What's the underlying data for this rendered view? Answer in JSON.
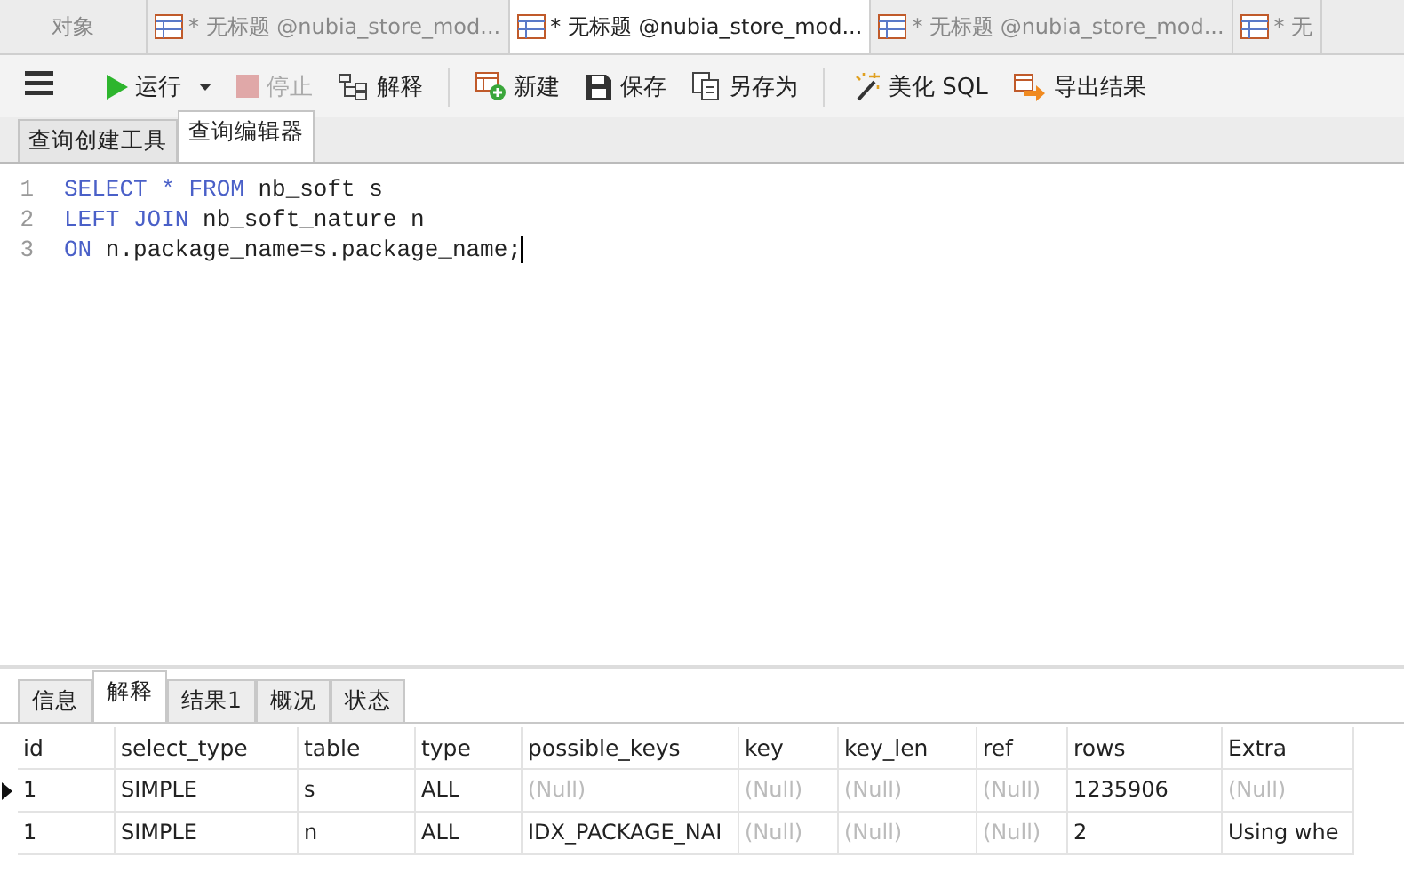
{
  "doc_tabs": [
    {
      "label": "对象",
      "kind": "plain",
      "selected": false
    },
    {
      "label": "* 无标题 @nubia_store_mod...",
      "kind": "query",
      "selected": false
    },
    {
      "label": "* 无标题 @nubia_store_mod...",
      "kind": "query",
      "selected": true
    },
    {
      "label": "* 无标题 @nubia_store_mod...",
      "kind": "query",
      "selected": false
    },
    {
      "label": "* 无",
      "kind": "query",
      "selected": false
    }
  ],
  "toolbar": [
    {
      "kind": "menu"
    },
    {
      "kind": "run",
      "label": "运行",
      "disabled": false
    },
    {
      "kind": "stop",
      "label": "停止",
      "disabled": true
    },
    {
      "kind": "explain",
      "label": "解释",
      "disabled": false
    },
    {
      "kind": "sep"
    },
    {
      "kind": "new",
      "label": "新建",
      "disabled": false
    },
    {
      "kind": "save",
      "label": "保存",
      "disabled": false
    },
    {
      "kind": "saveas",
      "label": "另存为",
      "disabled": false
    },
    {
      "kind": "sep"
    },
    {
      "kind": "beautify",
      "label": "美化 SQL",
      "disabled": false
    },
    {
      "kind": "export",
      "label": "导出结果",
      "disabled": false
    }
  ],
  "editor_tabs": [
    {
      "label": "查询创建工具",
      "selected": false
    },
    {
      "label": "查询编辑器",
      "selected": true
    }
  ],
  "code_lines": [
    {
      "number": "1",
      "tokens": [
        {
          "kind": "keyword",
          "text": "SELECT * FROM"
        },
        {
          "kind": "plain",
          "text": " nb_soft s"
        }
      ]
    },
    {
      "number": "2",
      "tokens": [
        {
          "kind": "keyword",
          "text": "LEFT JOIN"
        },
        {
          "kind": "plain",
          "text": " nb_soft_nature n"
        }
      ]
    },
    {
      "number": "3",
      "tokens": [
        {
          "kind": "keyword",
          "text": "ON"
        },
        {
          "kind": "plain",
          "text": " n.package_name=s.package_name;"
        }
      ]
    }
  ],
  "result_tabs": [
    {
      "label": "信息",
      "selected": false
    },
    {
      "label": "解释",
      "selected": true
    },
    {
      "label": "结果1",
      "selected": false
    },
    {
      "label": "概况",
      "selected": false
    },
    {
      "label": "状态",
      "selected": false
    }
  ],
  "table": {
    "columns": [
      "id",
      "select_type",
      "table",
      "type",
      "possible_keys",
      "key",
      "key_len",
      "ref",
      "rows",
      "Extra"
    ],
    "rows": [
      {
        "current": true,
        "cells": [
          {
            "text": "1",
            "is_null": false
          },
          {
            "text": "SIMPLE",
            "is_null": false
          },
          {
            "text": "s",
            "is_null": false
          },
          {
            "text": "ALL",
            "is_null": false
          },
          {
            "text": "(Null)",
            "is_null": true
          },
          {
            "text": "(Null)",
            "is_null": true
          },
          {
            "text": "(Null)",
            "is_null": true
          },
          {
            "text": "(Null)",
            "is_null": true
          },
          {
            "text": "1235906",
            "is_null": false
          },
          {
            "text": "(Null)",
            "is_null": true
          }
        ]
      },
      {
        "current": false,
        "cells": [
          {
            "text": "1",
            "is_null": false
          },
          {
            "text": "SIMPLE",
            "is_null": false
          },
          {
            "text": "n",
            "is_null": false
          },
          {
            "text": "ALL",
            "is_null": false
          },
          {
            "text": "IDX_PACKAGE_NAI",
            "is_null": false
          },
          {
            "text": "(Null)",
            "is_null": true
          },
          {
            "text": "(Null)",
            "is_null": true
          },
          {
            "text": "(Null)",
            "is_null": true
          },
          {
            "text": "2",
            "is_null": false
          },
          {
            "text": "Using whe",
            "is_null": false
          }
        ]
      }
    ]
  }
}
